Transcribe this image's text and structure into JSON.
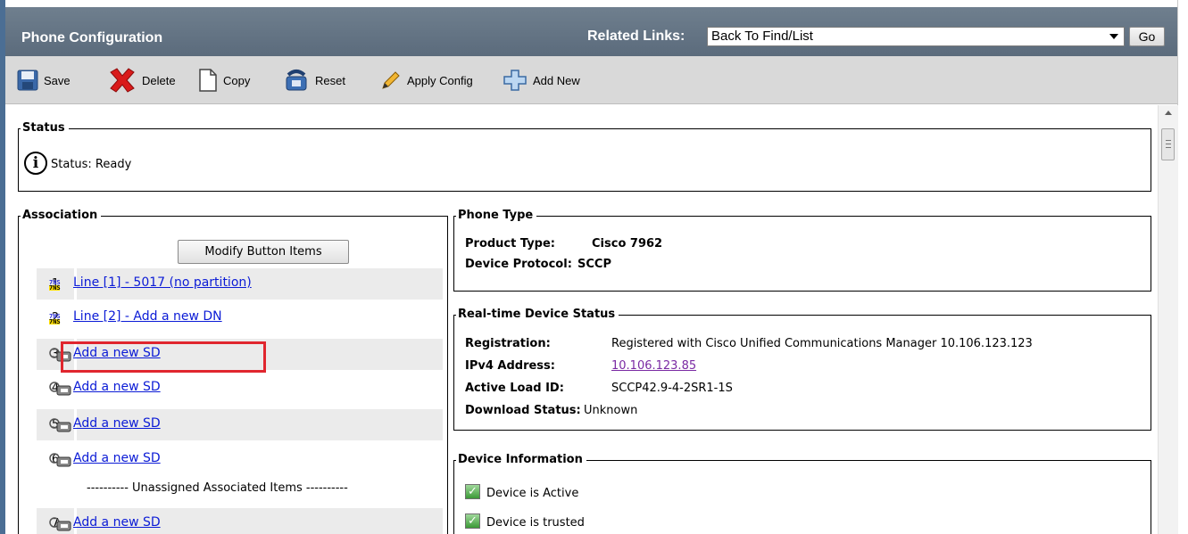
{
  "window": {
    "title": "Phone Configuration"
  },
  "related_links": {
    "label": "Related Links:",
    "selected": "Back To Find/List",
    "go_label": "Go"
  },
  "toolbar": {
    "save": "Save",
    "delete": "Delete",
    "copy": "Copy",
    "reset": "Reset",
    "apply_config": "Apply Config",
    "add_new": "Add New"
  },
  "status": {
    "legend": "Status",
    "text": "Status: Ready",
    "icon": "info-icon"
  },
  "association": {
    "legend": "Association",
    "modify_button": "Modify Button Items",
    "rows": [
      {
        "num": "1",
        "label": "Line [1] - 5017 (no partition)",
        "type": "line"
      },
      {
        "num": "2",
        "label": "Line [2] - Add a new DN",
        "type": "line"
      },
      {
        "num": "3",
        "label": "Add a new SD",
        "type": "speed-dial"
      },
      {
        "num": "4",
        "label": "Add a new SD",
        "type": "speed-dial"
      },
      {
        "num": "5",
        "label": "Add a new SD",
        "type": "speed-dial"
      },
      {
        "num": "6",
        "label": "Add a new SD",
        "type": "speed-dial"
      },
      {
        "num": "7",
        "label": "Add a new SD",
        "type": "speed-dial"
      }
    ],
    "unassigned_divider": "---------- Unassigned Associated Items ----------",
    "line_icon_text_top": "7NS",
    "line_icon_text_bottom": "7NS"
  },
  "phone_type": {
    "legend": "Phone Type",
    "product_type_label": "Product Type:",
    "product_type_value": "Cisco 7962",
    "device_protocol_label": "Device Protocol:",
    "device_protocol_value": "SCCP"
  },
  "realtime_status": {
    "legend": "Real-time Device Status",
    "registration_label": "Registration:",
    "registration_value": "Registered with Cisco Unified Communications Manager 10.106.123.123",
    "ipv4_label": "IPv4 Address:",
    "ipv4_value": "10.106.123.85",
    "active_load_label": "Active Load ID:",
    "active_load_value": "SCCP42.9-4-2SR1-1S",
    "download_status_label": "Download Status:",
    "download_status_value": "Unknown"
  },
  "device_information": {
    "legend": "Device Information",
    "items": [
      "Device is Active",
      "Device is trusted"
    ]
  },
  "colors": {
    "title_bar": "#5f6f80",
    "toolbar": "#d9d9d9",
    "link": "#0b1bd6",
    "highlight": "#e0262e"
  }
}
